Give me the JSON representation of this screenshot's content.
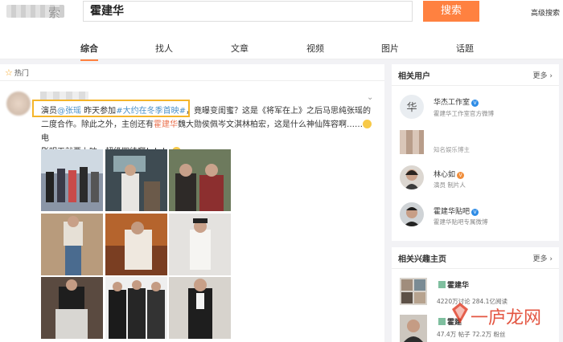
{
  "header": {
    "logo_char": "索",
    "search_value": "霍建华",
    "search_button": "搜索",
    "advanced_link": "高级搜索"
  },
  "tabs": [
    {
      "label": "综合",
      "active": true
    },
    {
      "label": "找人",
      "active": false
    },
    {
      "label": "文章",
      "active": false
    },
    {
      "label": "视频",
      "active": false
    },
    {
      "label": "图片",
      "active": false
    },
    {
      "label": "话题",
      "active": false
    }
  ],
  "feed": {
    "hot_label": "热门",
    "post": {
      "line1_a": "演员",
      "line1_mention": "@张瑶",
      "line1_b": " 昨天参加",
      "line1_topic": "#大约在冬季首映#",
      "line1_c": "，竟曝变闺蜜？这是《将军在上》之后马思纯张瑶的",
      "line2": "二度合作。除此之外，主创还有",
      "line2_name": "霍建华",
      "line2_b": "魏大勋侯佩岑文淇林柏宏，这是什么神仙阵容啊……",
      "line2_c": "电",
      "line3": "影明天就要上映，超级期待啊！！！"
    }
  },
  "sidebar": {
    "users_title": "相关用户",
    "users_more": "更多 ›",
    "users": [
      {
        "name": "华杰工作室",
        "desc": "霍建华工作室官方微博",
        "badge": "blue"
      },
      {
        "name": "",
        "desc": "知名娱乐博主",
        "badge": ""
      },
      {
        "name": "林心如",
        "desc": "演员 制片人",
        "badge": "orange"
      },
      {
        "name": "霍建华贴吧",
        "desc": "霍建华贴吧专属微博",
        "badge": "blue"
      }
    ],
    "topics_title": "相关兴趣主页",
    "topics_more": "更多 ›",
    "topics": [
      {
        "name": "霍建华",
        "stats": "4220万讨论 284.1亿阅读"
      },
      {
        "name": "霍建",
        "stats": "47.4万 帖子 72.2万 粉丝"
      }
    ]
  },
  "watermark": "一庐龙网"
}
